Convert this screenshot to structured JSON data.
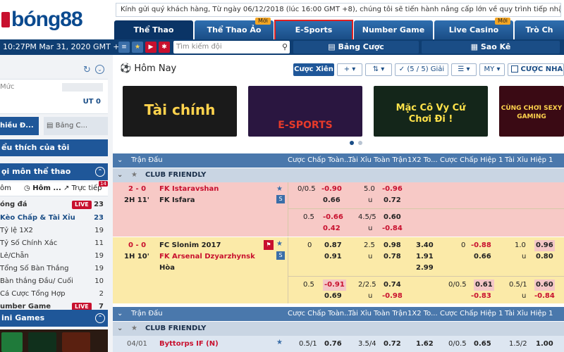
{
  "brand": {
    "logo_text": "bóng88"
  },
  "ticker": "Kính gửi quý khách hàng, Từ ngày 06/12/2018 (lúc 16:00 GMT +8), chúng tôi sẽ tiến hành nâng cấp lớn về quy trình tiếp nhận cược. Việc nâng c",
  "tabs": [
    {
      "label": "Thể Thao",
      "badge": ""
    },
    {
      "label": "Thể Thao Ảo",
      "badge": "Mới"
    },
    {
      "label": "E-Sports",
      "badge": ""
    },
    {
      "label": "Number Game",
      "badge": ""
    },
    {
      "label": "Live Casino",
      "badge": "Mới"
    },
    {
      "label": "Trò Ch",
      "badge": ""
    }
  ],
  "toolbar": {
    "clock": "10:27PM Mar 31, 2020 GMT +8",
    "search_placeholder": "Tìm kiếm đội",
    "bet_list": "Bảng Cược",
    "statement": "Sao Kê"
  },
  "sidebar": {
    "level_label": "Mức",
    "level_value": "",
    "ut_label": "UT",
    "ut_value": "0",
    "tab_promo": "hiều Đ...",
    "tab_bet": "Bảng C...",
    "fav_label": "ểu thích của tôi",
    "sports_head": "ọi môn thể thao",
    "filter_tabs": [
      "ôm",
      "Hôm ...",
      "Trực tiếp"
    ],
    "live_count": "14",
    "items": [
      {
        "label": "óng đá",
        "live": "LIVE",
        "count": "23"
      },
      {
        "label": "Kèo Chấp & Tài Xỉu",
        "live": "",
        "count": "23"
      },
      {
        "label": "Tỷ lệ 1X2",
        "live": "",
        "count": "19"
      },
      {
        "label": "Tỷ Số Chính Xác",
        "live": "",
        "count": "11"
      },
      {
        "label": "Lẻ/Chẵn",
        "live": "",
        "count": "19"
      },
      {
        "label": "Tổng Số Bàn Thắng",
        "live": "",
        "count": "19"
      },
      {
        "label": "Bàn thắng Đầu/ Cuối",
        "live": "",
        "count": "10"
      },
      {
        "label": "Cá Cược Tổng Hợp",
        "live": "",
        "count": "2"
      },
      {
        "label": "umber Game",
        "live": "LIVE",
        "count": "7"
      }
    ],
    "games_head": "ini Games"
  },
  "main": {
    "today": "Hôm Nay",
    "bet_type": "Cược Xiên",
    "plus": "+",
    "filter_count": "(5 / 5) Giải",
    "odds_type": "MY",
    "checkbox_label": "CƯỢC NHA",
    "banners": [
      {
        "text": "Tài chính",
        "bg": "#1a1a1a",
        "fg": "#ffd34d"
      },
      {
        "text": "E-SPORTS",
        "bg": "#2a1640",
        "fg": "#e63a2a"
      },
      {
        "text": "Mặc Cô Vy Cứ Chơi Đi !",
        "bg": "#14261a",
        "fg": "#ffe24a"
      },
      {
        "text": "CÙNG CHƠI SEXY GAMING",
        "bg": "#3a0a14",
        "fg": "#ffd34d"
      }
    ],
    "columns": [
      "Trận Đấu",
      "Cược Chấp Toàn...",
      "Tài Xỉu Toàn Trận",
      "1X2 To...",
      "Cược Chấp Hiệp 1",
      "Tài Xỉu Hiệp 1"
    ],
    "league1": "CLUB FRIENDLY",
    "match1": {
      "score": "2 - 0",
      "time": "2H 11'",
      "home": "FK Istaravshan",
      "away": "FK Isfara",
      "r1": {
        "hcap": "0/0.5",
        "h1": "-0.90",
        "h2": "0.66",
        "ou": "5.0",
        "ouu": "u",
        "o1": "-0.96",
        "o2": "0.72"
      },
      "r2": {
        "hcap": "0.5",
        "h1": "-0.66",
        "h2": "0.42",
        "ou": "4.5/5",
        "ouu": "u",
        "o1": "0.60",
        "o2": "-0.84"
      }
    },
    "match2": {
      "score": "0 - 0",
      "time": "1H 10'",
      "home": "FC Slonim 2017",
      "away": "FK Arsenal Dzyarzhynsk",
      "draw": "Hòa",
      "r1": {
        "hcap": "0",
        "h1": "0.87",
        "h2": "0.91",
        "ou": "2.5",
        "ouu": "u",
        "o1": "0.98",
        "o2": "0.78",
        "x1": "3.40",
        "x2": "1.91",
        "x3": "2.99",
        "fh": "0",
        "fh1": "-0.88",
        "fh2": "0.66",
        "fou": "1.0",
        "fouu": "u",
        "fo1": "0.96",
        "fo2": "0.80"
      },
      "r2": {
        "hcap": "0.5",
        "h1": "-0.91",
        "h2": "0.69",
        "ou": "2/2.5",
        "ouu": "u",
        "o1": "0.74",
        "o2": "-0.98",
        "fh": "0/0.5",
        "fh1": "0.61",
        "fh2": "-0.83",
        "fou": "0.5/1",
        "fouu": "u",
        "fo1": "0.60",
        "fo2": "-0.84"
      }
    },
    "league2": "CLUB FRIENDLY",
    "match3": {
      "date": "04/01",
      "home": "Byttorps IF (N)",
      "hcap": "0.5/1",
      "h1": "0.76",
      "ou": "3.5/4",
      "o1": "0.72",
      "x1": "1.62",
      "fh": "0/0.5",
      "fh1": "0.65",
      "fou": "1.5/2",
      "fo1": "1.00"
    }
  }
}
